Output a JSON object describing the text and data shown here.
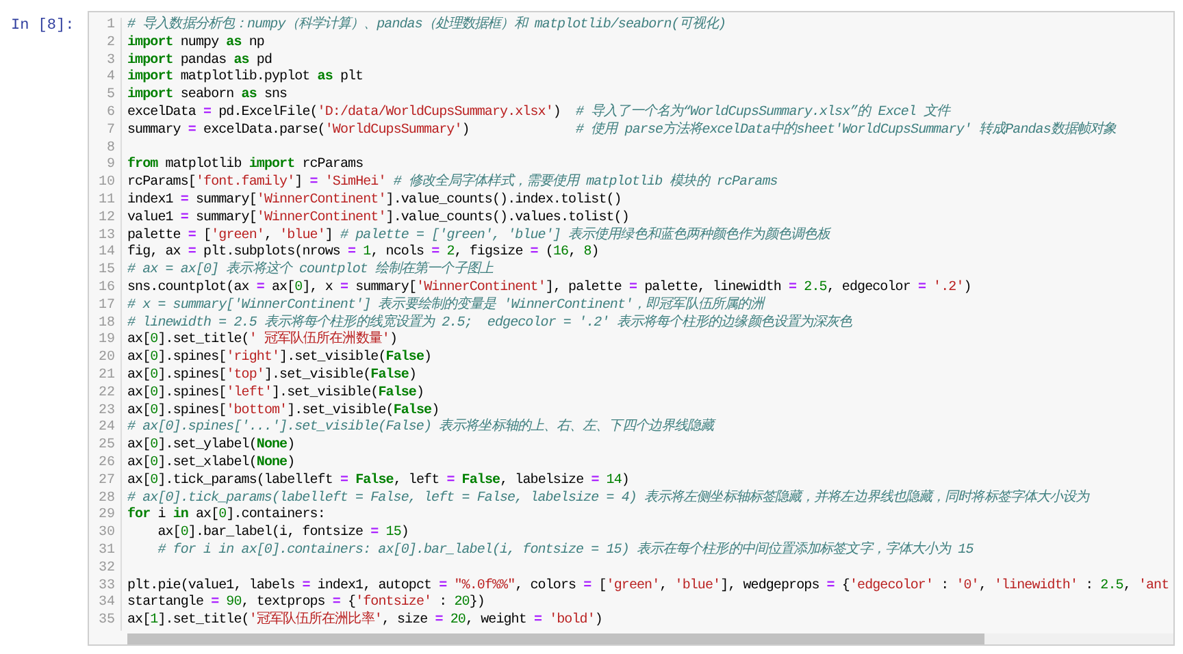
{
  "prompt": "In [8]:",
  "lines": [
    {
      "number": "1",
      "tokens": [
        {
          "kind": "comment",
          "text": "# 导入数据分析包：numpy（科学计算）、pandas（处理数据框）和 matplotlib/seaborn(可视化)"
        }
      ]
    },
    {
      "number": "2",
      "tokens": [
        {
          "kind": "keyword",
          "text": "import"
        },
        {
          "kind": "plain",
          "text": " numpy "
        },
        {
          "kind": "keyword",
          "text": "as"
        },
        {
          "kind": "plain",
          "text": " np"
        }
      ]
    },
    {
      "number": "3",
      "tokens": [
        {
          "kind": "keyword",
          "text": "import"
        },
        {
          "kind": "plain",
          "text": " pandas "
        },
        {
          "kind": "keyword",
          "text": "as"
        },
        {
          "kind": "plain",
          "text": " pd"
        }
      ]
    },
    {
      "number": "4",
      "tokens": [
        {
          "kind": "keyword",
          "text": "import"
        },
        {
          "kind": "plain",
          "text": " matplotlib.pyplot "
        },
        {
          "kind": "keyword",
          "text": "as"
        },
        {
          "kind": "plain",
          "text": " plt"
        }
      ]
    },
    {
      "number": "5",
      "tokens": [
        {
          "kind": "keyword",
          "text": "import"
        },
        {
          "kind": "plain",
          "text": " seaborn "
        },
        {
          "kind": "keyword",
          "text": "as"
        },
        {
          "kind": "plain",
          "text": " sns"
        }
      ]
    },
    {
      "number": "6",
      "tokens": [
        {
          "kind": "plain",
          "text": "excelData "
        },
        {
          "kind": "operator",
          "text": "="
        },
        {
          "kind": "plain",
          "text": " pd.ExcelFile("
        },
        {
          "kind": "string",
          "text": "'D:/data/WorldCupsSummary.xlsx'"
        },
        {
          "kind": "plain",
          "text": ")  "
        },
        {
          "kind": "comment",
          "text": "# 导入了一个名为“WorldCupsSummary.xlsx”的 Excel 文件"
        }
      ]
    },
    {
      "number": "7",
      "tokens": [
        {
          "kind": "plain",
          "text": "summary "
        },
        {
          "kind": "operator",
          "text": "="
        },
        {
          "kind": "plain",
          "text": " excelData.parse("
        },
        {
          "kind": "string",
          "text": "'WorldCupsSummary'"
        },
        {
          "kind": "plain",
          "text": ")              "
        },
        {
          "kind": "comment",
          "text": "# 使用 parse方法将excelData中的sheet'WorldCupsSummary' 转成Pandas数据帧对象"
        }
      ]
    },
    {
      "number": "8"
    },
    {
      "number": "9",
      "tokens": [
        {
          "kind": "keyword",
          "text": "from"
        },
        {
          "kind": "plain",
          "text": " matplotlib "
        },
        {
          "kind": "keyword",
          "text": "import"
        },
        {
          "kind": "plain",
          "text": " rcParams"
        }
      ]
    },
    {
      "number": "10",
      "tokens": [
        {
          "kind": "plain",
          "text": "rcParams["
        },
        {
          "kind": "string",
          "text": "'font.family'"
        },
        {
          "kind": "plain",
          "text": "] "
        },
        {
          "kind": "operator",
          "text": "= "
        },
        {
          "kind": "string",
          "text": "'SimHei'"
        },
        {
          "kind": "comment",
          "text": " # 修改全局字体样式，需要使用 matplotlib 模块的 rcParams"
        }
      ]
    },
    {
      "number": "11",
      "tokens": [
        {
          "kind": "plain",
          "text": "index1 "
        },
        {
          "kind": "operator",
          "text": "="
        },
        {
          "kind": "plain",
          "text": " summary["
        },
        {
          "kind": "string",
          "text": "'WinnerContinent'"
        },
        {
          "kind": "plain",
          "text": "].value_counts().index.tolist()"
        }
      ]
    },
    {
      "number": "12",
      "tokens": [
        {
          "kind": "plain",
          "text": "value1 "
        },
        {
          "kind": "operator",
          "text": "="
        },
        {
          "kind": "plain",
          "text": " summary["
        },
        {
          "kind": "string",
          "text": "'WinnerContinent'"
        },
        {
          "kind": "plain",
          "text": "].value_counts().values.tolist()"
        }
      ]
    },
    {
      "number": "13",
      "tokens": [
        {
          "kind": "plain",
          "text": "palette "
        },
        {
          "kind": "operator",
          "text": "="
        },
        {
          "kind": "plain",
          "text": " ["
        },
        {
          "kind": "string",
          "text": "'green'"
        },
        {
          "kind": "plain",
          "text": ", "
        },
        {
          "kind": "string",
          "text": "'blue'"
        },
        {
          "kind": "plain",
          "text": "] "
        },
        {
          "kind": "comment",
          "text": "# palette = ['green', 'blue'] 表示使用绿色和蓝色两种颜色作为颜色调色板"
        }
      ]
    },
    {
      "number": "14",
      "tokens": [
        {
          "kind": "plain",
          "text": "fig, ax "
        },
        {
          "kind": "operator",
          "text": "="
        },
        {
          "kind": "plain",
          "text": " plt.subplots(nrows "
        },
        {
          "kind": "operator",
          "text": "= "
        },
        {
          "kind": "number",
          "text": "1"
        },
        {
          "kind": "plain",
          "text": ", ncols "
        },
        {
          "kind": "operator",
          "text": "= "
        },
        {
          "kind": "number",
          "text": "2"
        },
        {
          "kind": "plain",
          "text": ", figsize "
        },
        {
          "kind": "operator",
          "text": "="
        },
        {
          "kind": "plain",
          "text": " ("
        },
        {
          "kind": "number",
          "text": "16"
        },
        {
          "kind": "plain",
          "text": ", "
        },
        {
          "kind": "number",
          "text": "8"
        },
        {
          "kind": "plain",
          "text": ")"
        }
      ]
    },
    {
      "number": "15",
      "tokens": [
        {
          "kind": "comment",
          "text": "# ax = ax[0] 表示将这个 countplot 绘制在第一个子图上"
        }
      ]
    },
    {
      "number": "16",
      "tokens": [
        {
          "kind": "plain",
          "text": "sns.countplot(ax "
        },
        {
          "kind": "operator",
          "text": "="
        },
        {
          "kind": "plain",
          "text": " ax["
        },
        {
          "kind": "number",
          "text": "0"
        },
        {
          "kind": "plain",
          "text": "], x "
        },
        {
          "kind": "operator",
          "text": "="
        },
        {
          "kind": "plain",
          "text": " summary["
        },
        {
          "kind": "string",
          "text": "'WinnerContinent'"
        },
        {
          "kind": "plain",
          "text": "], palette "
        },
        {
          "kind": "operator",
          "text": "="
        },
        {
          "kind": "plain",
          "text": " palette, linewidth "
        },
        {
          "kind": "operator",
          "text": "= "
        },
        {
          "kind": "number",
          "text": "2.5"
        },
        {
          "kind": "plain",
          "text": ", edgecolor "
        },
        {
          "kind": "operator",
          "text": "= "
        },
        {
          "kind": "string",
          "text": "'.2'"
        },
        {
          "kind": "plain",
          "text": ")"
        }
      ]
    },
    {
      "number": "17",
      "tokens": [
        {
          "kind": "comment",
          "text": "# x = summary['WinnerContinent'] 表示要绘制的变量是 'WinnerContinent'，即冠军队伍所属的洲"
        }
      ]
    },
    {
      "number": "18",
      "tokens": [
        {
          "kind": "comment",
          "text": "# linewidth = 2.5 表示将每个柱形的线宽设置为 2.5;  edgecolor = '.2' 表示将每个柱形的边缘颜色设置为深灰色"
        }
      ]
    },
    {
      "number": "19",
      "tokens": [
        {
          "kind": "plain",
          "text": "ax["
        },
        {
          "kind": "number",
          "text": "0"
        },
        {
          "kind": "plain",
          "text": "].set_title("
        },
        {
          "kind": "string",
          "text": "' 冠军队伍所在洲数量'"
        },
        {
          "kind": "plain",
          "text": ")"
        }
      ]
    },
    {
      "number": "20",
      "tokens": [
        {
          "kind": "plain",
          "text": "ax["
        },
        {
          "kind": "number",
          "text": "0"
        },
        {
          "kind": "plain",
          "text": "].spines["
        },
        {
          "kind": "string",
          "text": "'right'"
        },
        {
          "kind": "plain",
          "text": "].set_visible("
        },
        {
          "kind": "keyword",
          "text": "False"
        },
        {
          "kind": "plain",
          "text": ")"
        }
      ]
    },
    {
      "number": "21",
      "tokens": [
        {
          "kind": "plain",
          "text": "ax["
        },
        {
          "kind": "number",
          "text": "0"
        },
        {
          "kind": "plain",
          "text": "].spines["
        },
        {
          "kind": "string",
          "text": "'top'"
        },
        {
          "kind": "plain",
          "text": "].set_visible("
        },
        {
          "kind": "keyword",
          "text": "False"
        },
        {
          "kind": "plain",
          "text": ")"
        }
      ]
    },
    {
      "number": "22",
      "tokens": [
        {
          "kind": "plain",
          "text": "ax["
        },
        {
          "kind": "number",
          "text": "0"
        },
        {
          "kind": "plain",
          "text": "].spines["
        },
        {
          "kind": "string",
          "text": "'left'"
        },
        {
          "kind": "plain",
          "text": "].set_visible("
        },
        {
          "kind": "keyword",
          "text": "False"
        },
        {
          "kind": "plain",
          "text": ")"
        }
      ]
    },
    {
      "number": "23",
      "tokens": [
        {
          "kind": "plain",
          "text": "ax["
        },
        {
          "kind": "number",
          "text": "0"
        },
        {
          "kind": "plain",
          "text": "].spines["
        },
        {
          "kind": "string",
          "text": "'bottom'"
        },
        {
          "kind": "plain",
          "text": "].set_visible("
        },
        {
          "kind": "keyword",
          "text": "False"
        },
        {
          "kind": "plain",
          "text": ")"
        }
      ]
    },
    {
      "number": "24",
      "tokens": [
        {
          "kind": "comment",
          "text": "# ax[0].spines['...'].set_visible(False) 表示将坐标轴的上、右、左、下四个边界线隐藏"
        }
      ]
    },
    {
      "number": "25",
      "tokens": [
        {
          "kind": "plain",
          "text": "ax["
        },
        {
          "kind": "number",
          "text": "0"
        },
        {
          "kind": "plain",
          "text": "].set_ylabel("
        },
        {
          "kind": "keyword",
          "text": "None"
        },
        {
          "kind": "plain",
          "text": ")"
        }
      ]
    },
    {
      "number": "26",
      "tokens": [
        {
          "kind": "plain",
          "text": "ax["
        },
        {
          "kind": "number",
          "text": "0"
        },
        {
          "kind": "plain",
          "text": "].set_xlabel("
        },
        {
          "kind": "keyword",
          "text": "None"
        },
        {
          "kind": "plain",
          "text": ")"
        }
      ]
    },
    {
      "number": "27",
      "tokens": [
        {
          "kind": "plain",
          "text": "ax["
        },
        {
          "kind": "number",
          "text": "0"
        },
        {
          "kind": "plain",
          "text": "].tick_params(labelleft "
        },
        {
          "kind": "operator",
          "text": "= "
        },
        {
          "kind": "keyword",
          "text": "False"
        },
        {
          "kind": "plain",
          "text": ", left "
        },
        {
          "kind": "operator",
          "text": "= "
        },
        {
          "kind": "keyword",
          "text": "False"
        },
        {
          "kind": "plain",
          "text": ", labelsize "
        },
        {
          "kind": "operator",
          "text": "= "
        },
        {
          "kind": "number",
          "text": "14"
        },
        {
          "kind": "plain",
          "text": ")"
        }
      ]
    },
    {
      "number": "28",
      "tokens": [
        {
          "kind": "comment",
          "text": "# ax[0].tick_params(labelleft = False, left = False, labelsize = 4) 表示将左侧坐标轴标签隐藏，并将左边界线也隐藏，同时将标签字体大小设为"
        }
      ]
    },
    {
      "number": "29",
      "tokens": [
        {
          "kind": "keyword",
          "text": "for"
        },
        {
          "kind": "plain",
          "text": " i "
        },
        {
          "kind": "keyword",
          "text": "in"
        },
        {
          "kind": "plain",
          "text": " ax["
        },
        {
          "kind": "number",
          "text": "0"
        },
        {
          "kind": "plain",
          "text": "].containers:"
        }
      ]
    },
    {
      "number": "30",
      "tokens": [
        {
          "kind": "plain",
          "text": "    ax["
        },
        {
          "kind": "number",
          "text": "0"
        },
        {
          "kind": "plain",
          "text": "].bar_label(i, fontsize "
        },
        {
          "kind": "operator",
          "text": "= "
        },
        {
          "kind": "number",
          "text": "15"
        },
        {
          "kind": "plain",
          "text": ")"
        }
      ]
    },
    {
      "number": "31",
      "tokens": [
        {
          "kind": "comment",
          "text": "    # for i in ax[0].containers: ax[0].bar_label(i, fontsize = 15) 表示在每个柱形的中间位置添加标签文字，字体大小为 15"
        }
      ]
    },
    {
      "number": "32"
    },
    {
      "number": "33",
      "tokens": [
        {
          "kind": "plain",
          "text": "plt.pie(value1, labels "
        },
        {
          "kind": "operator",
          "text": "="
        },
        {
          "kind": "plain",
          "text": " index1, autopct "
        },
        {
          "kind": "operator",
          "text": "= "
        },
        {
          "kind": "string",
          "text": "\"%.0f%%\""
        },
        {
          "kind": "plain",
          "text": ", colors "
        },
        {
          "kind": "operator",
          "text": "="
        },
        {
          "kind": "plain",
          "text": " ["
        },
        {
          "kind": "string",
          "text": "'green'"
        },
        {
          "kind": "plain",
          "text": ", "
        },
        {
          "kind": "string",
          "text": "'blue'"
        },
        {
          "kind": "plain",
          "text": "], wedgeprops "
        },
        {
          "kind": "operator",
          "text": "="
        },
        {
          "kind": "plain",
          "text": " {"
        },
        {
          "kind": "string",
          "text": "'edgecolor'"
        },
        {
          "kind": "plain",
          "text": " : "
        },
        {
          "kind": "string",
          "text": "'0'"
        },
        {
          "kind": "plain",
          "text": ", "
        },
        {
          "kind": "string",
          "text": "'linewidth'"
        },
        {
          "kind": "plain",
          "text": " : "
        },
        {
          "kind": "number",
          "text": "2.5"
        },
        {
          "kind": "plain",
          "text": ", "
        },
        {
          "kind": "string",
          "text": "'ant"
        }
      ]
    },
    {
      "number": "34",
      "tokens": [
        {
          "kind": "plain",
          "text": "startangle "
        },
        {
          "kind": "operator",
          "text": "= "
        },
        {
          "kind": "number",
          "text": "90"
        },
        {
          "kind": "plain",
          "text": ", textprops "
        },
        {
          "kind": "operator",
          "text": "="
        },
        {
          "kind": "plain",
          "text": " {"
        },
        {
          "kind": "string",
          "text": "'fontsize'"
        },
        {
          "kind": "plain",
          "text": " : "
        },
        {
          "kind": "number",
          "text": "20"
        },
        {
          "kind": "plain",
          "text": "})"
        }
      ]
    },
    {
      "number": "35",
      "tokens": [
        {
          "kind": "plain",
          "text": "ax["
        },
        {
          "kind": "number",
          "text": "1"
        },
        {
          "kind": "plain",
          "text": "].set_title("
        },
        {
          "kind": "string",
          "text": "'冠军队伍所在洲比率'"
        },
        {
          "kind": "plain",
          "text": ", size "
        },
        {
          "kind": "operator",
          "text": "= "
        },
        {
          "kind": "number",
          "text": "20"
        },
        {
          "kind": "plain",
          "text": ", weight "
        },
        {
          "kind": "operator",
          "text": "= "
        },
        {
          "kind": "string",
          "text": "'bold'"
        },
        {
          "kind": "plain",
          "text": ")"
        }
      ]
    }
  ]
}
